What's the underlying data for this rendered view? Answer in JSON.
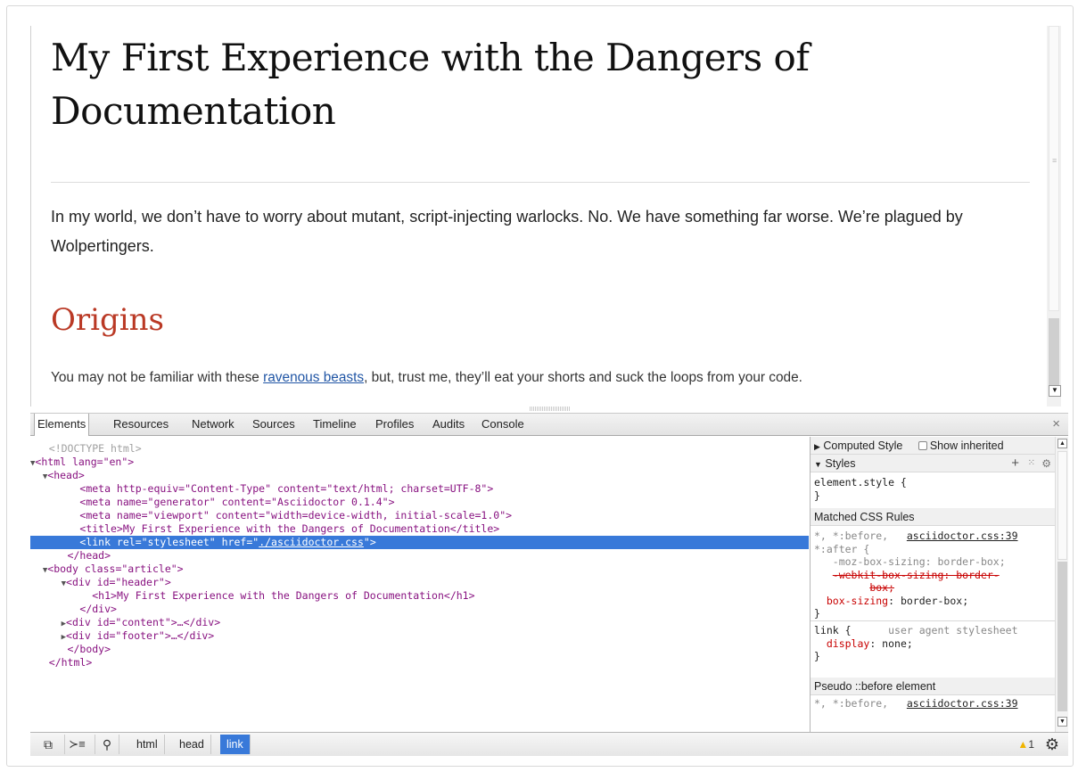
{
  "page": {
    "title": "My First Experience with the Dangers of Documentation",
    "intro": "In my world, we don’t have to worry about mutant, script-injecting warlocks. No. We have something far worse. We’re plagued by Wolpertingers.",
    "section_title": "Origins",
    "section_text_before": "You may not be familiar with these ",
    "section_link": "ravenous beasts",
    "section_text_after": ", but, trust me, they’ll eat your shorts and suck the loops from your code."
  },
  "devtools": {
    "tabs": [
      "Elements",
      "Resources",
      "Network",
      "Sources",
      "Timeline",
      "Profiles",
      "Audits",
      "Console"
    ],
    "close_label": "×",
    "dom": {
      "doctype": "<!DOCTYPE html>",
      "html_open": "<html lang=\"en\">",
      "head_open": "<head>",
      "meta1": "<meta http-equiv=\"Content-Type\" content=\"text/html; charset=UTF-8\">",
      "meta2": "<meta name=\"generator\" content=\"Asciidoctor 0.1.4\">",
      "meta3": "<meta name=\"viewport\" content=\"width=device-width, initial-scale=1.0\">",
      "title_line": "<title>My First Experience with the Dangers of Documentation</title>",
      "link_line_a": "<link rel=\"stylesheet\" href=\"",
      "link_line_href": "./asciidoctor.css",
      "link_line_b": "\">",
      "head_close": "</head>",
      "body_open": "<body class=\"article\">",
      "div_header": "<div id=\"header\">",
      "h1_line": "<h1>My First Experience with the Dangers of Documentation</h1>",
      "div_close": "</div>",
      "div_content": "<div id=\"content\">…</div>",
      "div_footer": "<div id=\"footer\">…</div>",
      "body_close": "</body>",
      "html_close": "</html>"
    },
    "sidebar": {
      "computed_style": "Computed Style",
      "show_inherited": "Show inherited",
      "styles": "Styles",
      "element_style": "element.style {",
      "close_brace": "}",
      "matched_rules": "Matched CSS Rules",
      "rule1_selector_a": "*, *:before,",
      "rule1_selector_b": "*:after {",
      "rule1_source": "asciidoctor.css:39",
      "rule1_prop1": "-moz-box-sizing: border-box;",
      "rule1_prop2a": "-webkit-box-sizing: border-",
      "rule1_prop2b": "box;",
      "rule1_prop3_name": "box-sizing",
      "rule1_prop3_val": ": border-box;",
      "rule2_selector": "link {",
      "rule2_source": "user agent stylesheet",
      "rule2_prop_name": "display",
      "rule2_prop_val": ": none;",
      "pseudo_before": "Pseudo ::before element",
      "rule3_selector": "*, *:before,",
      "rule3_source": "asciidoctor.css:39"
    },
    "breadcrumbs": [
      "html",
      "head",
      "link"
    ],
    "warning_count": "1"
  },
  "colors": {
    "selection": "#3879d9",
    "section_title": "#ba3925",
    "link": "#2156a5",
    "warning": "#f0b400"
  }
}
